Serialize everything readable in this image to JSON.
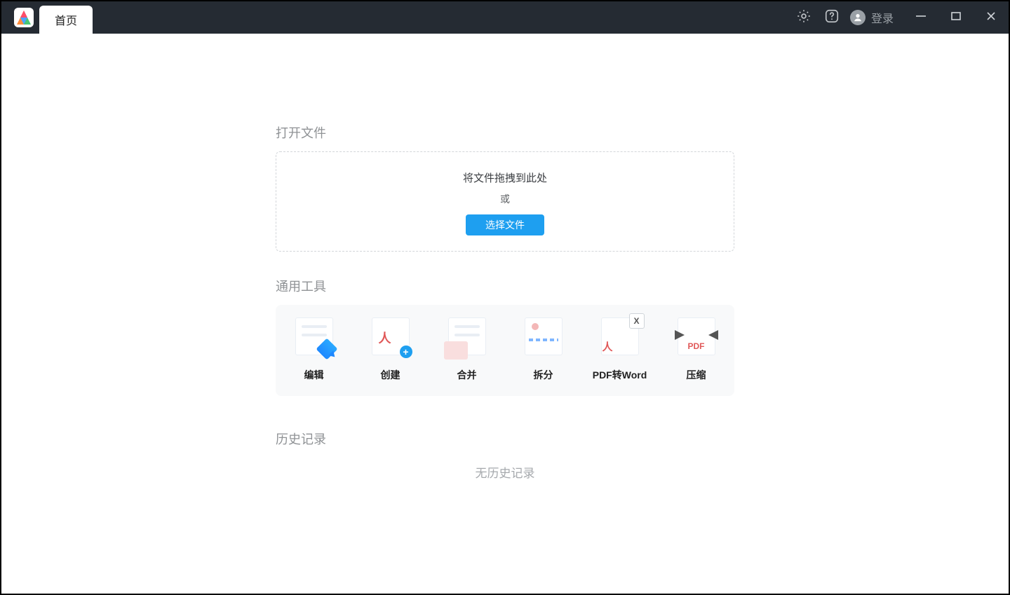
{
  "titlebar": {
    "tab_label": "首页",
    "login_label": "登录"
  },
  "open_file": {
    "section_title": "打开文件",
    "drag_text": "将文件拖拽到此处",
    "or_text": "或",
    "select_button": "选择文件"
  },
  "tools": {
    "section_title": "通用工具",
    "items": [
      {
        "id": "edit",
        "label": "编辑"
      },
      {
        "id": "create",
        "label": "创建"
      },
      {
        "id": "merge",
        "label": "合并"
      },
      {
        "id": "split",
        "label": "拆分"
      },
      {
        "id": "pdf2word",
        "label": "PDF转Word"
      },
      {
        "id": "compress",
        "label": "压缩"
      }
    ]
  },
  "history": {
    "section_title": "历史记录",
    "empty_text": "无历史记录"
  }
}
